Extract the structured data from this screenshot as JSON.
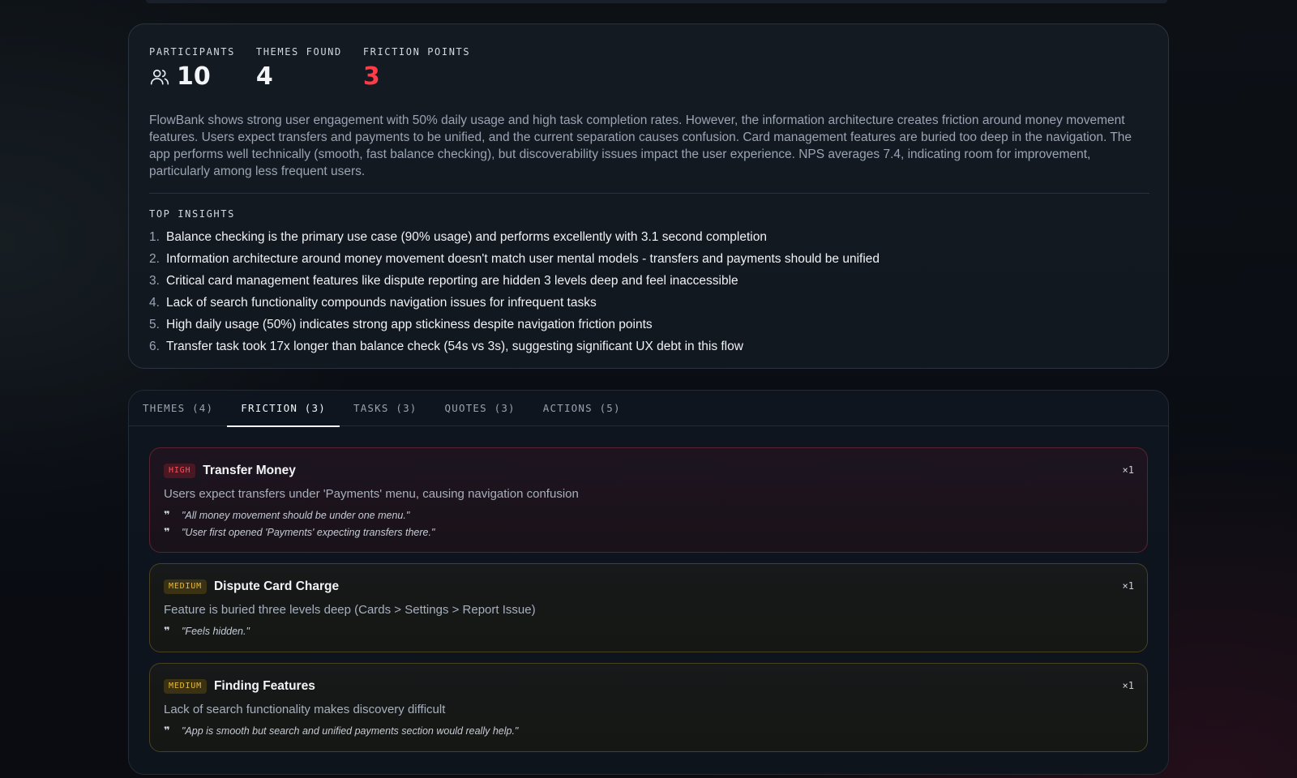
{
  "summary": {
    "stats": [
      {
        "label": "PARTICIPANTS",
        "value": "10",
        "icon": "users-icon"
      },
      {
        "label": "THEMES FOUND",
        "value": "4"
      },
      {
        "label": "FRICTION POINTS",
        "value": "3",
        "color": "#ff3b47"
      }
    ],
    "text": "FlowBank shows strong user engagement with 50% daily usage and high task completion rates. However, the information architecture creates friction around money movement features. Users expect transfers and payments to be unified, and the current separation causes confusion. Card management features are buried too deep in the navigation. The app performs well technically (smooth, fast balance checking), but discoverability issues impact the user experience. NPS averages 7.4, indicating room for improvement, particularly among less frequent users.",
    "insights_title": "TOP INSIGHTS",
    "insights": [
      {
        "num": "1.",
        "text": "Balance checking is the primary use case (90% usage) and performs excellently with 3.1 second completion"
      },
      {
        "num": "2.",
        "text": "Information architecture around money movement doesn't match user mental models - transfers and payments should be unified"
      },
      {
        "num": "3.",
        "text": "Critical card management features like dispute reporting are hidden 3 levels deep and feel inaccessible"
      },
      {
        "num": "4.",
        "text": "Lack of search functionality compounds navigation issues for infrequent tasks"
      },
      {
        "num": "5.",
        "text": "High daily usage (50%) indicates strong app stickiness despite navigation friction points"
      },
      {
        "num": "6.",
        "text": "Transfer task took 17x longer than balance check (54s vs 3s), suggesting significant UX debt in this flow"
      }
    ]
  },
  "tabs": [
    {
      "label": "THEMES (4)",
      "active": false
    },
    {
      "label": "FRICTION (3)",
      "active": true
    },
    {
      "label": "TASKS (3)",
      "active": false
    },
    {
      "label": "QUOTES (3)",
      "active": false
    },
    {
      "label": "ACTIONS (5)",
      "active": false
    }
  ],
  "friction": [
    {
      "severity": "HIGH",
      "title": "Transfer Money",
      "count": "×1",
      "description": "Users expect transfers under 'Payments' menu, causing navigation confusion",
      "quotes": [
        "\"All money movement should be under one menu.\"",
        "\"User first opened 'Payments' expecting transfers there.\""
      ]
    },
    {
      "severity": "MEDIUM",
      "title": "Dispute Card Charge",
      "count": "×1",
      "description": "Feature is buried three levels deep (Cards > Settings > Report Issue)",
      "quotes": [
        "\"Feels hidden.\""
      ]
    },
    {
      "severity": "MEDIUM",
      "title": "Finding Features",
      "count": "×1",
      "description": "Lack of search functionality makes discovery difficult",
      "quotes": [
        "\"App is smooth but search and unified payments section would really help.\""
      ]
    }
  ],
  "colors": {
    "high": "#ff4d5b",
    "medium": "#e8b93a",
    "accent_red": "#ff3b47"
  }
}
